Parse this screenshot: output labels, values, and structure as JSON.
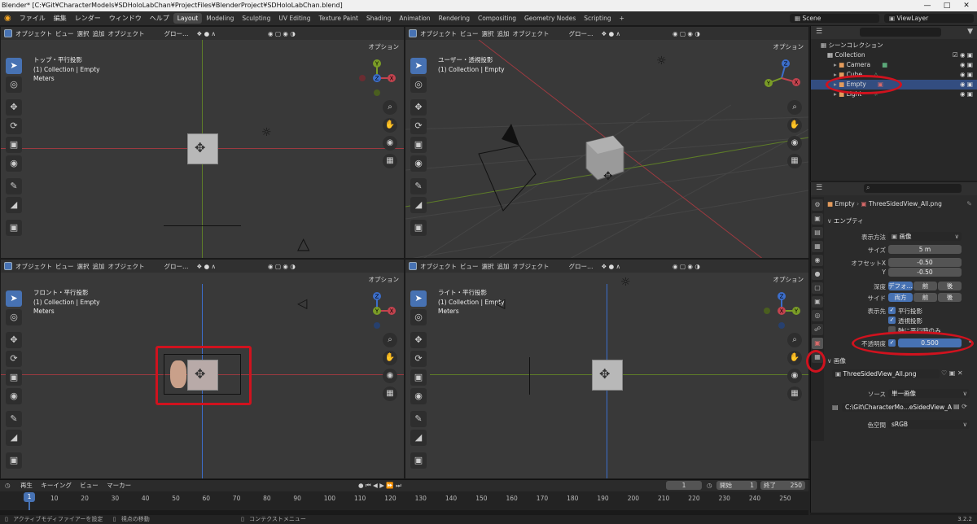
{
  "titlebar": {
    "text": "Blender* [C:¥Git¥CharacterModels¥SDHoloLabChan¥ProjectFiles¥BlenderProject¥SDHoloLabChan.blend]",
    "min": "—",
    "max": "□",
    "close": "✕"
  },
  "menus": [
    "ファイル",
    "編集",
    "レンダー",
    "ウィンドウ",
    "ヘルプ"
  ],
  "workspaces": [
    "Layout",
    "Modeling",
    "Sculpting",
    "UV Editing",
    "Texture Paint",
    "Shading",
    "Animation",
    "Rendering",
    "Compositing",
    "Geometry Nodes",
    "Scripting",
    "+"
  ],
  "scene": "Scene",
  "viewlayer": "ViewLayer",
  "vp_header": {
    "mode": "オブジェクト",
    "view": "ビュー",
    "select": "選択",
    "add": "追加",
    "object": "オブジェクト",
    "orient": "グロー…"
  },
  "options": "オプション",
  "viewports": {
    "tl": {
      "l1": "トップ・平行投影",
      "l2": "(1) Collection | Empty",
      "l3": "Meters"
    },
    "tr": {
      "l1": "ユーザー・透視投影",
      "l2": "(1) Collection | Empty"
    },
    "bl": {
      "l1": "フロント・平行投影",
      "l2": "(1) Collection | Empty",
      "l3": "Meters"
    },
    "br": {
      "l1": "ライト・平行投影",
      "l2": "(1) Collection | Empty",
      "l3": "Meters"
    }
  },
  "outliner": {
    "scene_collection": "シーンコレクション",
    "collection": "Collection",
    "items": [
      "Camera",
      "Cube",
      "Empty",
      "Light"
    ]
  },
  "props": {
    "breadcrumb_obj": "Empty",
    "breadcrumb_data": "ThreeSidedView_All.png",
    "section_empty": "エンプティ",
    "display_label": "表示方法",
    "display_value": "画像",
    "size_label": "サイズ",
    "size_value": "5 m",
    "offx_label": "オフセットX",
    "offx_value": "-0.50",
    "offy_label": "Y",
    "offy_value": "-0.50",
    "depth_label": "深度",
    "depth_opts": [
      "デフォ…",
      "前",
      "後"
    ],
    "side_label": "サイド",
    "side_opts": [
      "両方",
      "前",
      "後"
    ],
    "show_label": "表示先",
    "show_ortho": "平行投影",
    "show_persp": "透視投影",
    "show_aligned": "軸に平行時のみ",
    "opacity_label": "不透明度",
    "opacity_value": "0.500",
    "section_image": "画像",
    "image_name": "ThreeSidedView_All.png",
    "source_label": "ソース",
    "source_value": "単一画像",
    "filepath": "C:\\Git\\CharacterMo...eSidedView_All.png",
    "colorspace_label": "色空間",
    "colorspace_value": "sRGB"
  },
  "timeline": {
    "playback": "再生",
    "keying": "キーイング",
    "view": "ビュー",
    "marker": "マーカー",
    "current": "1",
    "start_label": "開始",
    "start": "1",
    "end_label": "終了",
    "end": "250",
    "ticks": [
      "10",
      "20",
      "30",
      "40",
      "50",
      "60",
      "70",
      "80",
      "90",
      "100",
      "110",
      "120",
      "130",
      "140",
      "150",
      "160",
      "170",
      "180",
      "190",
      "200",
      "210",
      "220",
      "230",
      "240",
      "250"
    ],
    "cursor": "1"
  },
  "status": {
    "s1": "アクティブモディファイアーを設定",
    "s2": "視点の移動",
    "s3": "コンテクストメニュー",
    "version": "3.2.2"
  },
  "gizmo": {
    "x": "X",
    "y": "Y",
    "z": "Z"
  },
  "colors": {
    "accent": "#4772b3",
    "annotation": "#d0121e",
    "x_axis": "#c2434e",
    "y_axis": "#7a9c27",
    "z_axis": "#3c6ecb"
  }
}
